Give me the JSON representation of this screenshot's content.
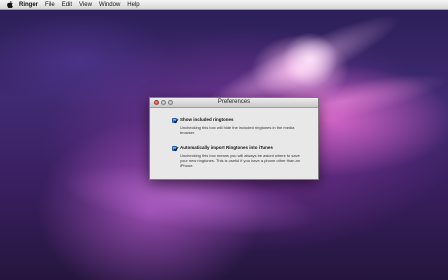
{
  "menubar": {
    "app_name": "Ringer",
    "items": [
      "File",
      "Edit",
      "View",
      "Window",
      "Help"
    ]
  },
  "dialog": {
    "title": "Preferences",
    "options": [
      {
        "label": "Show included ringtones",
        "checked": true,
        "description": "Unchecking this box will hide the included ringtones in the media browser."
      },
      {
        "label": "Automatically import Ringtones into iTunes",
        "checked": true,
        "description": "Unchecking this box means you will always be asked where to save your new ringtones. This is useful if you have a phone other than an iPhone."
      }
    ]
  },
  "colors": {
    "checkbox_accent": "#2a70d0",
    "close_button": "#d6332a",
    "wallpaper_highlight": "#e66ed2"
  }
}
